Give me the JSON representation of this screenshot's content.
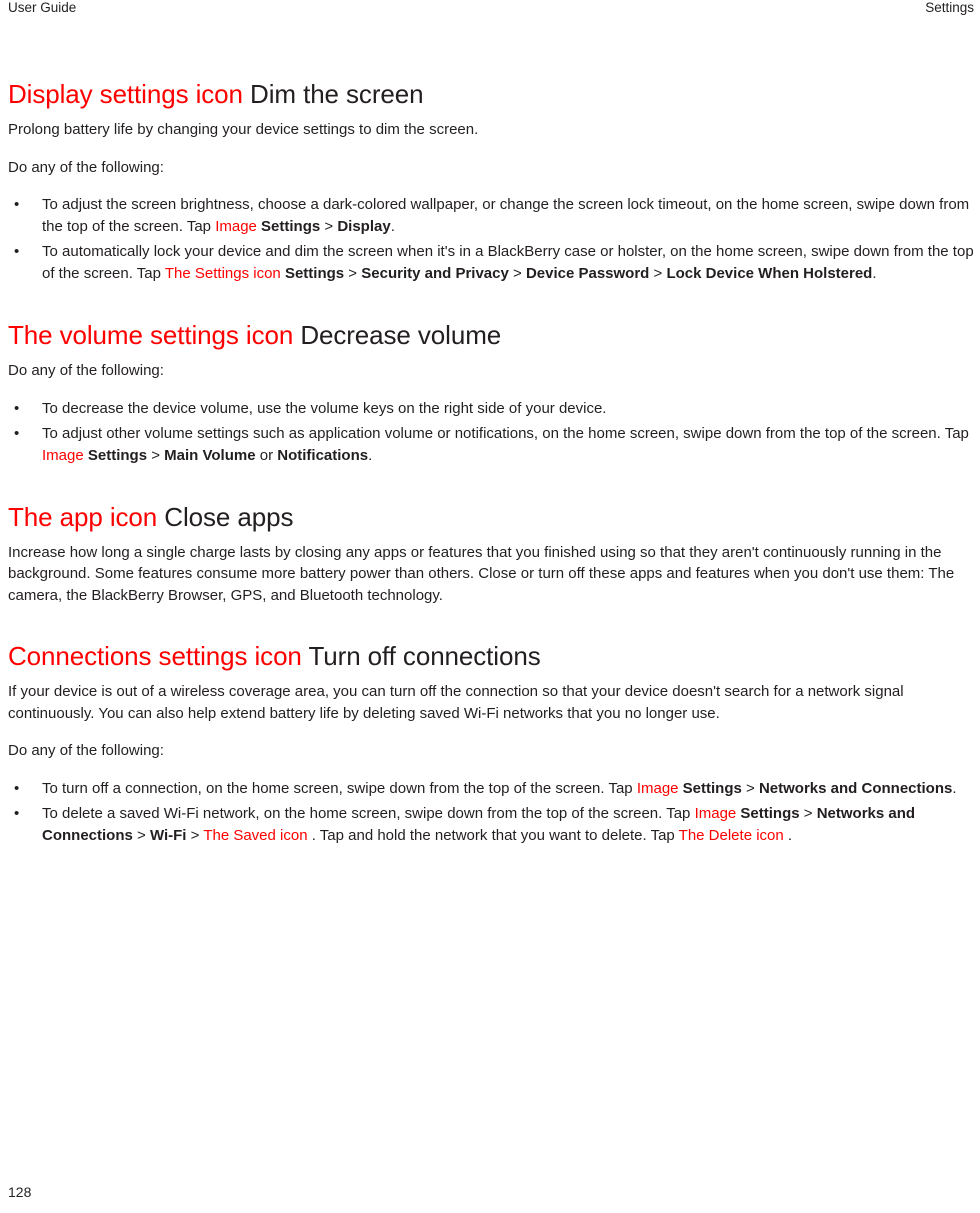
{
  "header": {
    "left": "User Guide",
    "right": "Settings"
  },
  "footer": {
    "page_number": "128"
  },
  "colors": {
    "icon_placeholder_red": "#ff0000",
    "body_text": "#231f20",
    "background": "#ffffff"
  },
  "sections": [
    {
      "icon_label": "Display settings icon",
      "title": "Dim the screen",
      "intro": "Prolong battery life by changing your device settings to dim the screen.",
      "lead_in": "Do any of the following:",
      "bullets": [
        {
          "marker": "•",
          "runs": [
            {
              "text": "To adjust the screen brightness, choose a dark-colored wallpaper, or change the screen lock timeout, on the home screen, swipe down from the top of the screen. Tap ",
              "style": "plain"
            },
            {
              "text": " Image ",
              "style": "red"
            },
            {
              "text": " Settings",
              "style": "bold"
            },
            {
              "text": " > ",
              "style": "plain"
            },
            {
              "text": "Display",
              "style": "bold"
            },
            {
              "text": ".",
              "style": "plain"
            }
          ]
        },
        {
          "marker": "•",
          "runs": [
            {
              "text": "To automatically lock your device and dim the screen when it's in a BlackBerry case or holster, on the home screen, swipe down from the top of the screen. Tap ",
              "style": "plain"
            },
            {
              "text": " The Settings icon ",
              "style": "red"
            },
            {
              "text": " Settings",
              "style": "bold"
            },
            {
              "text": " > ",
              "style": "plain"
            },
            {
              "text": "Security and Privacy",
              "style": "bold"
            },
            {
              "text": " > ",
              "style": "plain"
            },
            {
              "text": "Device Password",
              "style": "bold"
            },
            {
              "text": " > ",
              "style": "plain"
            },
            {
              "text": "Lock Device When Holstered",
              "style": "bold"
            },
            {
              "text": ".",
              "style": "plain"
            }
          ]
        }
      ]
    },
    {
      "icon_label": "The volume settings icon",
      "title": "Decrease volume",
      "intro": "",
      "lead_in": "Do any of the following:",
      "bullets": [
        {
          "marker": "•",
          "runs": [
            {
              "text": "To decrease the device volume, use the volume keys on the right side of your device.",
              "style": "plain"
            }
          ]
        },
        {
          "marker": "•",
          "runs": [
            {
              "text": "To adjust other volume settings such as application volume or notifications, on the home screen, swipe down from the top of the screen. Tap ",
              "style": "plain"
            },
            {
              "text": " Image ",
              "style": "red"
            },
            {
              "text": " Settings",
              "style": "bold"
            },
            {
              "text": " > ",
              "style": "plain"
            },
            {
              "text": "Main Volume",
              "style": "bold"
            },
            {
              "text": " or ",
              "style": "plain"
            },
            {
              "text": "Notifications",
              "style": "bold"
            },
            {
              "text": ".",
              "style": "plain"
            }
          ]
        }
      ]
    },
    {
      "icon_label": "The app icon",
      "title": "Close apps",
      "intro": "Increase how long a single charge lasts by closing any apps or features that you finished using so that they aren't continuously running in the background. Some features consume more battery power than others. Close or turn off these apps and features when you don't use them: The camera, the BlackBerry Browser, GPS, and Bluetooth technology.",
      "lead_in": "",
      "bullets": []
    },
    {
      "icon_label": "Connections settings icon",
      "title": "Turn off connections",
      "intro": "If your device is out of a wireless coverage area, you can turn off the connection so that your device doesn't search for a network signal continuously. You can also help extend battery life by deleting saved Wi-Fi networks that you no longer use.",
      "lead_in": "Do any of the following:",
      "bullets": [
        {
          "marker": "•",
          "runs": [
            {
              "text": "To turn off a connection, on the home screen, swipe down from the top of the screen. Tap ",
              "style": "plain"
            },
            {
              "text": " Image ",
              "style": "red"
            },
            {
              "text": " Settings",
              "style": "bold"
            },
            {
              "text": " > ",
              "style": "plain"
            },
            {
              "text": "Networks and Connections",
              "style": "bold"
            },
            {
              "text": ".",
              "style": "plain"
            }
          ]
        },
        {
          "marker": "•",
          "runs": [
            {
              "text": "To delete a saved Wi-Fi network, on the home screen, swipe down from the top of the screen. Tap ",
              "style": "plain"
            },
            {
              "text": " Image ",
              "style": "red"
            },
            {
              "text": "Settings",
              "style": "bold"
            },
            {
              "text": " > ",
              "style": "plain"
            },
            {
              "text": "Networks and Connections",
              "style": "bold"
            },
            {
              "text": " > ",
              "style": "plain"
            },
            {
              "text": "Wi-Fi",
              "style": "bold"
            },
            {
              "text": " > ",
              "style": "plain"
            },
            {
              "text": " The Saved icon ",
              "style": "red"
            },
            {
              "text": ". Tap and hold the network that you want to delete. Tap ",
              "style": "plain"
            },
            {
              "text": " The Delete icon ",
              "style": "red"
            },
            {
              "text": ".",
              "style": "plain"
            }
          ]
        }
      ]
    }
  ]
}
